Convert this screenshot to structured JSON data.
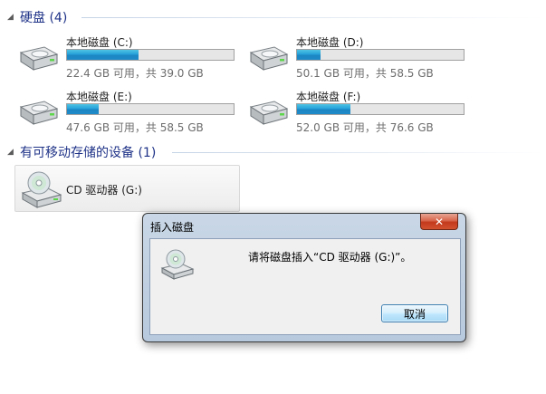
{
  "hard_disks": {
    "title": "硬盘 (4)",
    "drives": [
      {
        "name": "本地磁盘 (C:)",
        "space": "22.4 GB 可用，共 39.0 GB",
        "used_fraction": 0.43
      },
      {
        "name": "本地磁盘 (D:)",
        "space": "50.1 GB 可用，共 58.5 GB",
        "used_fraction": 0.14
      },
      {
        "name": "本地磁盘 (E:)",
        "space": "47.6 GB 可用，共 58.5 GB",
        "used_fraction": 0.19
      },
      {
        "name": "本地磁盘 (F:)",
        "space": "52.0 GB 可用，共 76.6 GB",
        "used_fraction": 0.32
      }
    ]
  },
  "removable": {
    "title": "有可移动存储的设备 (1)",
    "devices": [
      {
        "name": "CD 驱动器 (G:)"
      }
    ]
  },
  "dialog": {
    "title": "插入磁盘",
    "close_label": "✕",
    "message": "请将磁盘插入“CD 驱动器 (G:)”。",
    "cancel_label": "取消"
  },
  "colors": {
    "header_text": "#1e3287",
    "bar_fill": "#26a0da"
  }
}
